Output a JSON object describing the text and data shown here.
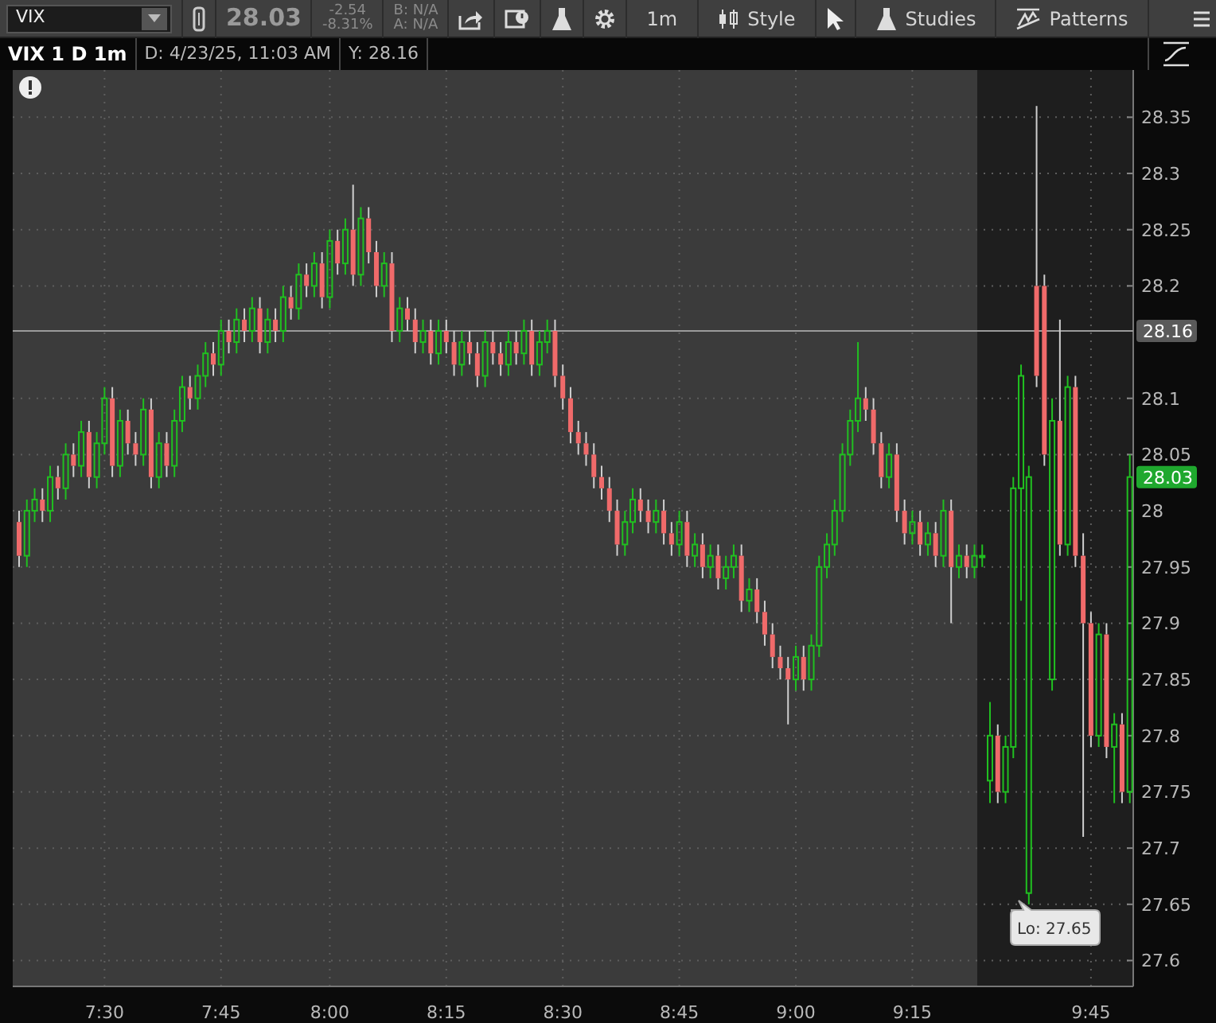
{
  "toolbar": {
    "symbol": "VIX",
    "last_price": "28.03",
    "net_change": "-2.54",
    "percent_change": "-8.31%",
    "bid": "B: N/A",
    "ask": "A: N/A",
    "aggregation": "1m",
    "style_label": "Style",
    "studies_label": "Studies",
    "patterns_label": "Patterns"
  },
  "info_bar": {
    "title": "VIX 1 D 1m",
    "date": "D: 4/23/25, 11:03 AM",
    "y_value": "Y: 28.16"
  },
  "chart": {
    "chart_data": {
      "type": "candlestick",
      "categories": [
        null,
        null,
        null,
        null,
        null,
        null,
        null,
        null,
        null,
        null,
        null,
        "7:30",
        null,
        null,
        null,
        null,
        null,
        null,
        null,
        null,
        null,
        null,
        null,
        null,
        null,
        null,
        "7:45",
        null,
        null,
        null,
        null,
        null,
        null,
        null,
        null,
        null,
        null,
        null,
        null,
        null,
        "8:00",
        null,
        null,
        null,
        null,
        null,
        null,
        null,
        null,
        null,
        null,
        null,
        null,
        null,
        null,
        "8:15",
        null,
        null,
        null,
        null,
        null,
        null,
        null,
        null,
        null,
        null,
        null,
        null,
        null,
        null,
        "8:30",
        null,
        null,
        null,
        null,
        null,
        null,
        null,
        null,
        null,
        null,
        null,
        null,
        null,
        null,
        "8:45",
        null,
        null,
        null,
        null,
        null,
        null,
        null,
        null,
        null,
        null,
        null,
        null,
        null,
        null,
        "9:00",
        null,
        null,
        null,
        null,
        null,
        null,
        null,
        null,
        null,
        null,
        null,
        null,
        null,
        null,
        "9:15",
        null,
        null,
        null,
        null,
        null,
        null,
        null,
        null,
        null,
        null,
        null,
        null,
        null,
        null,
        null,
        null,
        null,
        null,
        null,
        null,
        null,
        null,
        "9:45",
        null,
        null,
        null,
        null,
        null
      ],
      "ohlc": [
        [
          27.99,
          28.0,
          27.95,
          27.96
        ],
        [
          27.96,
          28.01,
          27.95,
          28.0
        ],
        [
          28.0,
          28.02,
          27.99,
          28.01
        ],
        [
          28.01,
          28.02,
          27.99,
          28.0
        ],
        [
          28.0,
          28.04,
          27.99,
          28.03
        ],
        [
          28.03,
          28.04,
          28.01,
          28.02
        ],
        [
          28.02,
          28.06,
          28.01,
          28.05
        ],
        [
          28.05,
          28.06,
          28.03,
          28.04
        ],
        [
          28.04,
          28.08,
          28.03,
          28.07
        ],
        [
          28.07,
          28.08,
          28.02,
          28.03
        ],
        [
          28.03,
          28.07,
          28.02,
          28.06
        ],
        [
          28.06,
          28.11,
          28.05,
          28.1
        ],
        [
          28.1,
          28.11,
          28.03,
          28.04
        ],
        [
          28.04,
          28.09,
          28.03,
          28.08
        ],
        [
          28.08,
          28.09,
          28.05,
          28.06
        ],
        [
          28.06,
          28.07,
          28.04,
          28.05
        ],
        [
          28.05,
          28.1,
          28.04,
          28.09
        ],
        [
          28.09,
          28.1,
          28.02,
          28.03
        ],
        [
          28.03,
          28.07,
          28.02,
          28.06
        ],
        [
          28.06,
          28.07,
          28.03,
          28.04
        ],
        [
          28.04,
          28.09,
          28.03,
          28.08
        ],
        [
          28.08,
          28.12,
          28.07,
          28.11
        ],
        [
          28.11,
          28.12,
          28.09,
          28.1
        ],
        [
          28.1,
          28.13,
          28.09,
          28.12
        ],
        [
          28.12,
          28.15,
          28.11,
          28.14
        ],
        [
          28.14,
          28.15,
          28.12,
          28.13
        ],
        [
          28.13,
          28.17,
          28.12,
          28.16
        ],
        [
          28.16,
          28.17,
          28.14,
          28.15
        ],
        [
          28.15,
          28.18,
          28.14,
          28.17
        ],
        [
          28.17,
          28.18,
          28.15,
          28.16
        ],
        [
          28.16,
          28.19,
          28.15,
          28.18
        ],
        [
          28.18,
          28.19,
          28.14,
          28.15
        ],
        [
          28.15,
          28.18,
          28.14,
          28.17
        ],
        [
          28.17,
          28.18,
          28.15,
          28.16
        ],
        [
          28.16,
          28.2,
          28.15,
          28.19
        ],
        [
          28.19,
          28.2,
          28.17,
          28.18
        ],
        [
          28.18,
          28.22,
          28.17,
          28.21
        ],
        [
          28.21,
          28.22,
          28.19,
          28.2
        ],
        [
          28.2,
          28.23,
          28.19,
          28.22
        ],
        [
          28.22,
          28.23,
          28.18,
          28.19
        ],
        [
          28.19,
          28.25,
          28.18,
          28.24
        ],
        [
          28.24,
          28.25,
          28.21,
          28.22
        ],
        [
          28.22,
          28.26,
          28.21,
          28.25
        ],
        [
          28.25,
          28.29,
          28.2,
          28.21
        ],
        [
          28.21,
          28.27,
          28.2,
          28.26
        ],
        [
          28.26,
          28.27,
          28.22,
          28.23
        ],
        [
          28.23,
          28.24,
          28.19,
          28.2
        ],
        [
          28.2,
          28.23,
          28.19,
          28.22
        ],
        [
          28.22,
          28.23,
          28.15,
          28.16
        ],
        [
          28.16,
          28.19,
          28.15,
          28.18
        ],
        [
          28.18,
          28.19,
          28.16,
          28.17
        ],
        [
          28.17,
          28.18,
          28.14,
          28.15
        ],
        [
          28.15,
          28.17,
          28.14,
          28.16
        ],
        [
          28.16,
          28.17,
          28.13,
          28.14
        ],
        [
          28.14,
          28.17,
          28.13,
          28.16
        ],
        [
          28.16,
          28.17,
          28.14,
          28.15
        ],
        [
          28.15,
          28.16,
          28.12,
          28.13
        ],
        [
          28.13,
          28.16,
          28.12,
          28.15
        ],
        [
          28.15,
          28.16,
          28.13,
          28.14
        ],
        [
          28.14,
          28.15,
          28.11,
          28.12
        ],
        [
          28.12,
          28.16,
          28.11,
          28.15
        ],
        [
          28.15,
          28.16,
          28.13,
          28.14
        ],
        [
          28.14,
          28.15,
          28.12,
          28.13
        ],
        [
          28.13,
          28.16,
          28.12,
          28.15
        ],
        [
          28.15,
          28.16,
          28.13,
          28.14
        ],
        [
          28.14,
          28.17,
          28.13,
          28.16
        ],
        [
          28.16,
          28.17,
          28.12,
          28.13
        ],
        [
          28.13,
          28.16,
          28.12,
          28.15
        ],
        [
          28.15,
          28.17,
          28.14,
          28.16
        ],
        [
          28.16,
          28.17,
          28.11,
          28.12
        ],
        [
          28.12,
          28.13,
          28.09,
          28.1
        ],
        [
          28.1,
          28.11,
          28.06,
          28.07
        ],
        [
          28.07,
          28.08,
          28.05,
          28.06
        ],
        [
          28.06,
          28.07,
          28.04,
          28.05
        ],
        [
          28.05,
          28.06,
          28.02,
          28.03
        ],
        [
          28.03,
          28.04,
          28.01,
          28.02
        ],
        [
          28.02,
          28.03,
          27.99,
          28.0
        ],
        [
          28.0,
          28.01,
          27.96,
          27.97
        ],
        [
          27.97,
          28.0,
          27.96,
          27.99
        ],
        [
          27.99,
          28.02,
          27.98,
          28.01
        ],
        [
          28.01,
          28.02,
          27.99,
          28.0
        ],
        [
          28.0,
          28.01,
          27.98,
          27.99
        ],
        [
          27.99,
          28.01,
          27.98,
          28.0
        ],
        [
          28.0,
          28.01,
          27.97,
          27.98
        ],
        [
          27.98,
          27.99,
          27.96,
          27.97
        ],
        [
          27.97,
          28.0,
          27.96,
          27.99
        ],
        [
          27.99,
          28.0,
          27.95,
          27.96
        ],
        [
          27.96,
          27.98,
          27.95,
          27.97
        ],
        [
          27.97,
          27.98,
          27.94,
          27.95
        ],
        [
          27.95,
          27.97,
          27.94,
          27.96
        ],
        [
          27.96,
          27.97,
          27.93,
          27.94
        ],
        [
          27.94,
          27.96,
          27.93,
          27.95
        ],
        [
          27.95,
          27.97,
          27.94,
          27.96
        ],
        [
          27.96,
          27.97,
          27.91,
          27.92
        ],
        [
          27.92,
          27.94,
          27.91,
          27.93
        ],
        [
          27.93,
          27.94,
          27.9,
          27.91
        ],
        [
          27.91,
          27.92,
          27.88,
          27.89
        ],
        [
          27.89,
          27.9,
          27.86,
          27.87
        ],
        [
          27.87,
          27.88,
          27.85,
          27.86
        ],
        [
          27.86,
          27.87,
          27.81,
          27.85
        ],
        [
          27.85,
          27.88,
          27.84,
          27.87
        ],
        [
          27.87,
          27.88,
          27.84,
          27.85
        ],
        [
          27.85,
          27.89,
          27.84,
          27.88
        ],
        [
          27.88,
          27.96,
          27.87,
          27.95
        ],
        [
          27.95,
          27.98,
          27.94,
          27.97
        ],
        [
          27.97,
          28.01,
          27.96,
          28.0
        ],
        [
          28.0,
          28.06,
          27.99,
          28.05
        ],
        [
          28.05,
          28.09,
          28.04,
          28.08
        ],
        [
          28.08,
          28.15,
          28.07,
          28.1
        ],
        [
          28.1,
          28.11,
          28.08,
          28.09
        ],
        [
          28.09,
          28.1,
          28.05,
          28.06
        ],
        [
          28.06,
          28.07,
          28.02,
          28.03
        ],
        [
          28.03,
          28.06,
          28.02,
          28.05
        ],
        [
          28.05,
          28.06,
          27.99,
          28.0
        ],
        [
          28.0,
          28.01,
          27.97,
          27.98
        ],
        [
          27.98,
          28.0,
          27.97,
          27.99
        ],
        [
          27.99,
          28.0,
          27.96,
          27.97
        ],
        [
          27.97,
          27.99,
          27.96,
          27.98
        ],
        [
          27.98,
          27.99,
          27.95,
          27.96
        ],
        [
          27.96,
          28.01,
          27.95,
          28.0
        ],
        [
          28.0,
          28.01,
          27.9,
          27.95
        ],
        [
          27.95,
          27.97,
          27.94,
          27.96
        ],
        [
          27.96,
          27.97,
          27.94,
          27.95
        ],
        [
          27.95,
          27.97,
          27.94,
          27.96
        ],
        [
          27.96,
          27.97,
          27.95,
          27.96
        ],
        [
          27.76,
          27.83,
          27.74,
          27.8
        ],
        [
          27.8,
          27.81,
          27.74,
          27.75
        ],
        [
          27.75,
          27.8,
          27.74,
          27.79
        ],
        [
          27.79,
          28.03,
          27.78,
          28.02
        ],
        [
          28.02,
          28.13,
          27.92,
          28.12
        ],
        [
          27.66,
          28.04,
          27.65,
          28.03
        ],
        [
          28.2,
          28.36,
          28.11,
          28.12
        ],
        [
          28.2,
          28.21,
          28.04,
          28.05
        ],
        [
          27.85,
          28.1,
          27.84,
          28.08
        ],
        [
          28.08,
          28.17,
          27.96,
          27.97
        ],
        [
          27.97,
          28.12,
          27.96,
          28.11
        ],
        [
          28.11,
          28.12,
          27.95,
          27.96
        ],
        [
          27.96,
          27.98,
          27.71,
          27.9
        ],
        [
          27.9,
          27.91,
          27.79,
          27.8
        ],
        [
          27.8,
          27.9,
          27.79,
          27.89
        ],
        [
          27.89,
          27.9,
          27.78,
          27.79
        ],
        [
          27.79,
          27.82,
          27.74,
          27.81
        ],
        [
          27.81,
          27.82,
          27.74,
          27.75
        ],
        [
          27.75,
          28.05,
          27.74,
          28.03
        ]
      ],
      "ylim": [
        27.577,
        28.392
      ],
      "yticks": [
        28.35,
        28.3,
        28.25,
        28.2,
        28.1,
        28.05,
        28,
        27.95,
        27.9,
        27.85,
        27.8,
        27.75,
        27.7,
        27.65,
        27.6
      ],
      "grid": true,
      "ref_lines": [
        {
          "axis": "y",
          "value": 28.16
        }
      ]
    },
    "price_tags": [
      {
        "text": "28.16",
        "color": "#5a5a5a"
      },
      {
        "text": "28.03",
        "color": "#1fa82e"
      }
    ],
    "low_tooltip": "Lo: 27.65"
  }
}
